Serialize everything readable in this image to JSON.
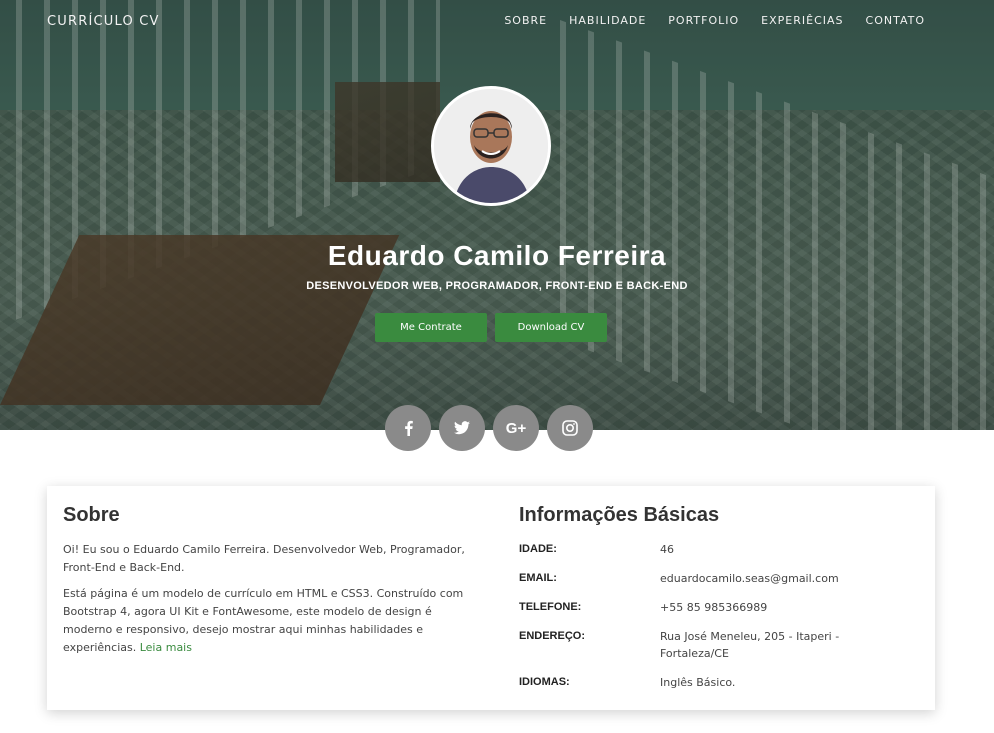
{
  "brand": "CURRÍCULO CV",
  "nav": [
    "SOBRE",
    "HABILIDADE",
    "PORTFOLIO",
    "EXPERIÊCIAS",
    "CONTATO"
  ],
  "hero": {
    "name": "Eduardo Camilo Ferreira",
    "role": "DESENVOLVEDOR WEB, PROGRAMADOR, FRONT-END E BACK-END",
    "btn_hire": "Me Contrate",
    "btn_download": "Download CV"
  },
  "socials": [
    "facebook-icon",
    "twitter-icon",
    "google-plus-icon",
    "instagram-icon"
  ],
  "about": {
    "title": "Sobre",
    "p1": "Oi! Eu sou o Eduardo Camilo Ferreira. Desenvolvedor Web, Programador, Front-End e Back-End.",
    "p2": "Está página é um modelo de currículo em HTML e CSS3. Construído com Bootstrap 4, agora UI Kit e FontAwesome, este modelo de design é moderno e responsivo, desejo mostrar aqui minhas habilidades e experiências.",
    "more": "Leia mais"
  },
  "info": {
    "title": "Informações Básicas",
    "rows": [
      {
        "k": "IDADE:",
        "v": "46"
      },
      {
        "k": "EMAIL:",
        "v": "eduardocamilo.seas@gmail.com"
      },
      {
        "k": "TELEFONE:",
        "v": "+55 85 985366989"
      },
      {
        "k": "ENDEREÇO:",
        "v": "Rua José Meneleu, 205 - Itaperi - Fortaleza/CE"
      },
      {
        "k": "IDIOMAS:",
        "v": "Inglês Básico."
      }
    ]
  }
}
